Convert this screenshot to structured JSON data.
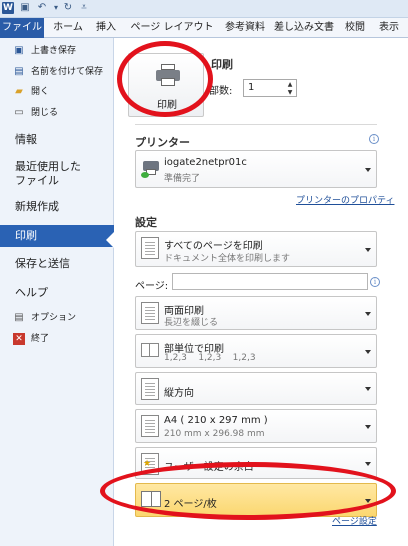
{
  "titlebar": {
    "app_icon": "W",
    "save_icon": "save-icon",
    "undo_icon": "undo-icon",
    "redo_icon": "redo-icon",
    "customize_icon": "customize-icon"
  },
  "tabs": [
    {
      "label": "ファイル"
    },
    {
      "label": "ホーム"
    },
    {
      "label": "挿入"
    },
    {
      "label": "ページ レイアウト"
    },
    {
      "label": "参考資料"
    },
    {
      "label": "差し込み文書"
    },
    {
      "label": "校閲"
    },
    {
      "label": "表示"
    }
  ],
  "leftnav": {
    "small_items": [
      {
        "label": "上書き保存",
        "icon": "save-icon"
      },
      {
        "label": "名前を付けて保存",
        "icon": "save-as-icon"
      },
      {
        "label": "開く",
        "icon": "open-folder-icon"
      },
      {
        "label": "閉じる",
        "icon": "close-doc-icon"
      }
    ],
    "info": "情報",
    "recent": "最近使用した\nファイル",
    "new": "新規作成",
    "print": "印刷",
    "save_send": "保存と送信",
    "help": "ヘルプ",
    "options": "オプション",
    "exit": "終了"
  },
  "main": {
    "print_title": "印刷",
    "print_button": "印刷",
    "copies_label": "部数:",
    "copies_value": "1",
    "printer_title": "プリンター",
    "printer_name": "iogate2netpr01c",
    "printer_status": "準備完了",
    "printer_props": "プリンターのプロパティ",
    "settings_title": "設定",
    "settings": [
      {
        "line1": "すべてのページを印刷",
        "line2": "ドキュメント全体を印刷します"
      },
      {
        "line1": "両面印刷",
        "line2": "長辺を綴じる"
      },
      {
        "line1": "部単位で印刷",
        "line2": "1,2,3    1,2,3    1,2,3"
      },
      {
        "line1": "縦方向",
        "line2": ""
      },
      {
        "line1": "A4 ( 210 x 297 mm )",
        "line2": "210 mm x 296.98 mm"
      },
      {
        "line1": "ユーザー設定の余白",
        "line2": ""
      },
      {
        "line1": "2 ページ/枚",
        "line2": ""
      }
    ],
    "pages_label": "ページ:",
    "page_setup": "ページ設定"
  },
  "colors": {
    "accent": "#2a62b4",
    "highlight": "#fbd770",
    "annotation": "#e2121c"
  }
}
